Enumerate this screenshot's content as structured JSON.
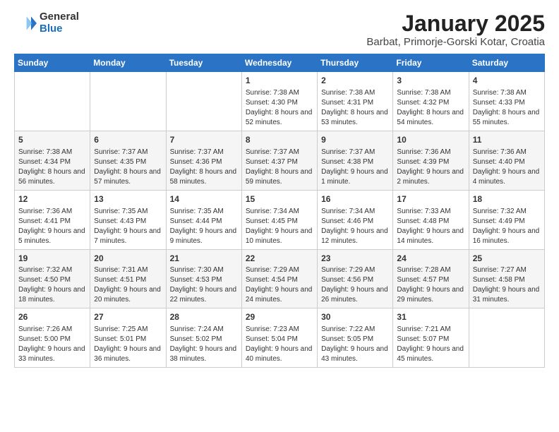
{
  "header": {
    "logo_general": "General",
    "logo_blue": "Blue",
    "title": "January 2025",
    "subtitle": "Barbat, Primorje-Gorski Kotar, Croatia"
  },
  "weekdays": [
    "Sunday",
    "Monday",
    "Tuesday",
    "Wednesday",
    "Thursday",
    "Friday",
    "Saturday"
  ],
  "weeks": [
    [
      {
        "day": "",
        "info": ""
      },
      {
        "day": "",
        "info": ""
      },
      {
        "day": "",
        "info": ""
      },
      {
        "day": "1",
        "info": "Sunrise: 7:38 AM\nSunset: 4:30 PM\nDaylight: 8 hours and 52 minutes."
      },
      {
        "day": "2",
        "info": "Sunrise: 7:38 AM\nSunset: 4:31 PM\nDaylight: 8 hours and 53 minutes."
      },
      {
        "day": "3",
        "info": "Sunrise: 7:38 AM\nSunset: 4:32 PM\nDaylight: 8 hours and 54 minutes."
      },
      {
        "day": "4",
        "info": "Sunrise: 7:38 AM\nSunset: 4:33 PM\nDaylight: 8 hours and 55 minutes."
      }
    ],
    [
      {
        "day": "5",
        "info": "Sunrise: 7:38 AM\nSunset: 4:34 PM\nDaylight: 8 hours and 56 minutes."
      },
      {
        "day": "6",
        "info": "Sunrise: 7:37 AM\nSunset: 4:35 PM\nDaylight: 8 hours and 57 minutes."
      },
      {
        "day": "7",
        "info": "Sunrise: 7:37 AM\nSunset: 4:36 PM\nDaylight: 8 hours and 58 minutes."
      },
      {
        "day": "8",
        "info": "Sunrise: 7:37 AM\nSunset: 4:37 PM\nDaylight: 8 hours and 59 minutes."
      },
      {
        "day": "9",
        "info": "Sunrise: 7:37 AM\nSunset: 4:38 PM\nDaylight: 9 hours and 1 minute."
      },
      {
        "day": "10",
        "info": "Sunrise: 7:36 AM\nSunset: 4:39 PM\nDaylight: 9 hours and 2 minutes."
      },
      {
        "day": "11",
        "info": "Sunrise: 7:36 AM\nSunset: 4:40 PM\nDaylight: 9 hours and 4 minutes."
      }
    ],
    [
      {
        "day": "12",
        "info": "Sunrise: 7:36 AM\nSunset: 4:41 PM\nDaylight: 9 hours and 5 minutes."
      },
      {
        "day": "13",
        "info": "Sunrise: 7:35 AM\nSunset: 4:43 PM\nDaylight: 9 hours and 7 minutes."
      },
      {
        "day": "14",
        "info": "Sunrise: 7:35 AM\nSunset: 4:44 PM\nDaylight: 9 hours and 9 minutes."
      },
      {
        "day": "15",
        "info": "Sunrise: 7:34 AM\nSunset: 4:45 PM\nDaylight: 9 hours and 10 minutes."
      },
      {
        "day": "16",
        "info": "Sunrise: 7:34 AM\nSunset: 4:46 PM\nDaylight: 9 hours and 12 minutes."
      },
      {
        "day": "17",
        "info": "Sunrise: 7:33 AM\nSunset: 4:48 PM\nDaylight: 9 hours and 14 minutes."
      },
      {
        "day": "18",
        "info": "Sunrise: 7:32 AM\nSunset: 4:49 PM\nDaylight: 9 hours and 16 minutes."
      }
    ],
    [
      {
        "day": "19",
        "info": "Sunrise: 7:32 AM\nSunset: 4:50 PM\nDaylight: 9 hours and 18 minutes."
      },
      {
        "day": "20",
        "info": "Sunrise: 7:31 AM\nSunset: 4:51 PM\nDaylight: 9 hours and 20 minutes."
      },
      {
        "day": "21",
        "info": "Sunrise: 7:30 AM\nSunset: 4:53 PM\nDaylight: 9 hours and 22 minutes."
      },
      {
        "day": "22",
        "info": "Sunrise: 7:29 AM\nSunset: 4:54 PM\nDaylight: 9 hours and 24 minutes."
      },
      {
        "day": "23",
        "info": "Sunrise: 7:29 AM\nSunset: 4:56 PM\nDaylight: 9 hours and 26 minutes."
      },
      {
        "day": "24",
        "info": "Sunrise: 7:28 AM\nSunset: 4:57 PM\nDaylight: 9 hours and 29 minutes."
      },
      {
        "day": "25",
        "info": "Sunrise: 7:27 AM\nSunset: 4:58 PM\nDaylight: 9 hours and 31 minutes."
      }
    ],
    [
      {
        "day": "26",
        "info": "Sunrise: 7:26 AM\nSunset: 5:00 PM\nDaylight: 9 hours and 33 minutes."
      },
      {
        "day": "27",
        "info": "Sunrise: 7:25 AM\nSunset: 5:01 PM\nDaylight: 9 hours and 36 minutes."
      },
      {
        "day": "28",
        "info": "Sunrise: 7:24 AM\nSunset: 5:02 PM\nDaylight: 9 hours and 38 minutes."
      },
      {
        "day": "29",
        "info": "Sunrise: 7:23 AM\nSunset: 5:04 PM\nDaylight: 9 hours and 40 minutes."
      },
      {
        "day": "30",
        "info": "Sunrise: 7:22 AM\nSunset: 5:05 PM\nDaylight: 9 hours and 43 minutes."
      },
      {
        "day": "31",
        "info": "Sunrise: 7:21 AM\nSunset: 5:07 PM\nDaylight: 9 hours and 45 minutes."
      },
      {
        "day": "",
        "info": ""
      }
    ]
  ]
}
